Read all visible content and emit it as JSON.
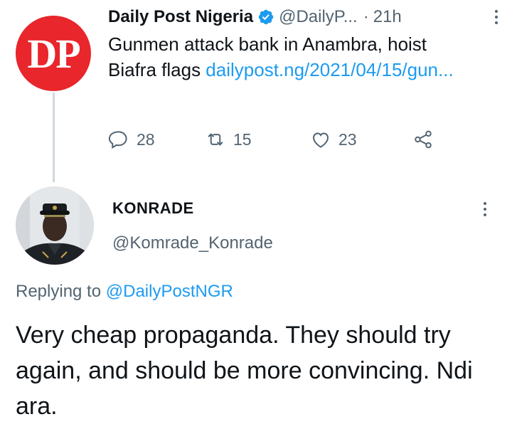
{
  "source_tweet": {
    "avatar_text": "DP",
    "name": "Daily Post Nigeria",
    "handle": "@DailyP...",
    "separator": "·",
    "time": "21h",
    "text": "Gunmen attack bank in Anambra, hoist Biafra flags ",
    "link": "dailypost.ng/2021/04/15/gun...",
    "stats": {
      "replies": "28",
      "retweets": "15",
      "likes": "23"
    }
  },
  "reply": {
    "name": "KONRADE",
    "handle": "@Komrade_Konrade",
    "replying_prefix": "Replying to ",
    "replying_to": "@DailyPostNGR",
    "text": "Very cheap propaganda. They should try again, and should be more convincing. Ndi ara."
  },
  "colors": {
    "accent": "#1d9bf0",
    "muted": "#536471",
    "brand_red": "#e8262b"
  }
}
